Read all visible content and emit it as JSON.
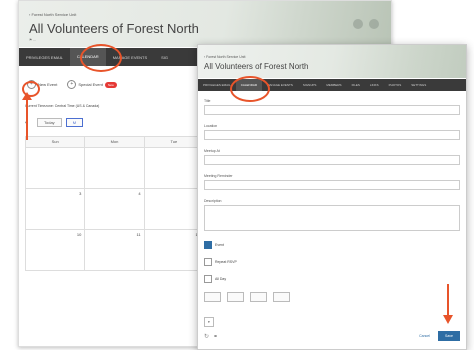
{
  "back_window": {
    "breadcrumb": "‹ Forest North Service Unit",
    "title": "All Volunteers of Forest North",
    "subtitle": "⚑ ...",
    "nav": [
      "PRIVILEGES EMAIL",
      "CALENDAR",
      "MANAGE EVENTS",
      "SIG"
    ],
    "active_nav": "CALENDAR",
    "actions": {
      "new_event_label": "New Event",
      "special_event_label": "Special Event",
      "special_badge": "New"
    },
    "timezone_note": "Current Timezone: Central Time (US & Canada)",
    "calendar_nav": {
      "today_label": "Today",
      "selected_label": "M"
    },
    "weekday_headers": [
      "Sun",
      "Mon",
      "Tue"
    ],
    "cells": [
      "",
      "",
      "",
      "3",
      "4",
      "5",
      "10",
      "11",
      "12"
    ]
  },
  "modal": {
    "breadcrumb": "‹ Forest North Service Unit",
    "title": "All Volunteers of Forest North",
    "nav": [
      "PRIVILEGES EMAIL",
      "CALENDAR",
      "MANAGE EVENTS",
      "SIGNUPS",
      "MEMBERS",
      "FILES",
      "LINKS",
      "PHOTOS",
      "SETTINGS"
    ],
    "active_nav": "CALENDAR",
    "form": {
      "title_label": "Title",
      "location_label": "Location",
      "meetup_at_label": "Meetup At",
      "meetup_at_value": "",
      "meeting_reminder_label": "Meeting Reminder",
      "meeting_reminder_value": "",
      "description_label": "Description",
      "checkbox_one": "Event",
      "checkbox_two": "Repeat RSVP",
      "checkbox_three": "All Day",
      "option_buttons": [
        "",
        "",
        "",
        ""
      ],
      "select_value": ""
    },
    "footer": {
      "cancel_label": "Cancel",
      "save_label": "Save"
    }
  },
  "colors": {
    "annotation": "#e8542a",
    "primary": "#2e6da4",
    "nav_bg": "#3a3a3a",
    "badge": "#e53935"
  }
}
